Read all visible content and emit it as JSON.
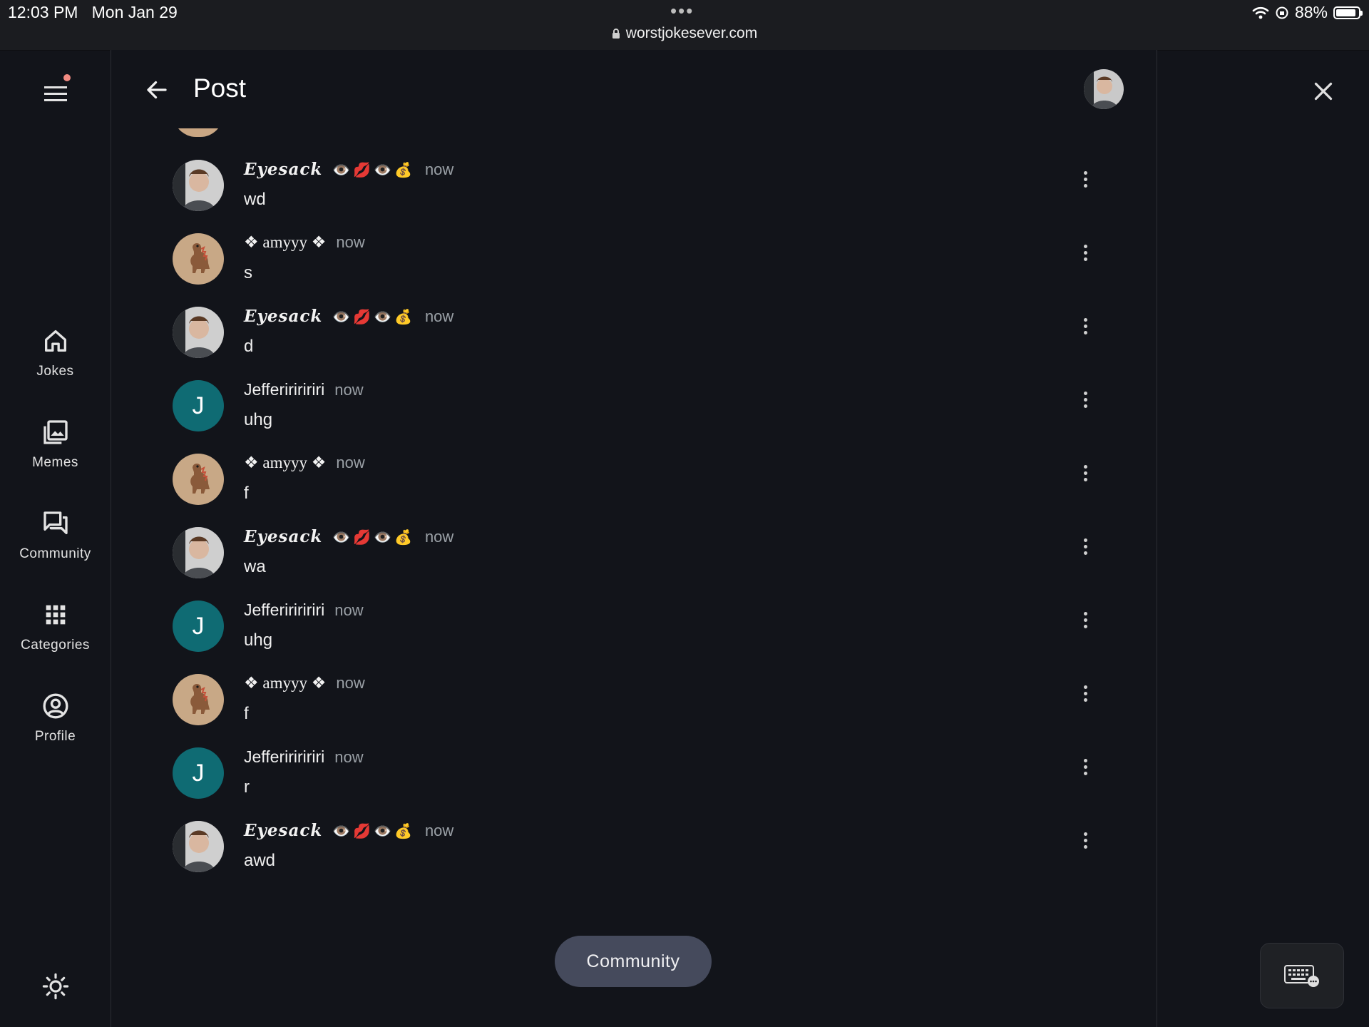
{
  "status_bar": {
    "time": "12:03 PM",
    "date": "Mon Jan 29",
    "url": "worstjokesever.com",
    "battery": "88%",
    "more_dots": "•••"
  },
  "nav": {
    "items": [
      {
        "label": "Jokes",
        "icon": "home-icon"
      },
      {
        "label": "Memes",
        "icon": "image-gallery-icon"
      },
      {
        "label": "Community",
        "icon": "forum-icon"
      },
      {
        "label": "Categories",
        "icon": "grid-icon"
      },
      {
        "label": "Profile",
        "icon": "account-circle-icon"
      }
    ],
    "menu_icon": "hamburger-menu-icon",
    "theme_icon": "brightness-icon"
  },
  "header": {
    "title": "Post",
    "back_icon": "arrow-left-icon",
    "close_icon": "close-icon"
  },
  "comments": [
    {
      "author": "Eyesack",
      "emojis": "👁️💋👁️💰",
      "time": "now",
      "text": "wd",
      "avatar": "photo"
    },
    {
      "author": "❖ amyyy ❖",
      "emojis": "",
      "time": "now",
      "text": "s",
      "avatar": "dino"
    },
    {
      "author": "Eyesack",
      "emojis": "👁️💋👁️💰",
      "time": "now",
      "text": "d",
      "avatar": "photo"
    },
    {
      "author": "Jeffeririririri",
      "emojis": "",
      "time": "now",
      "text": "uhg",
      "avatar": "J"
    },
    {
      "author": "❖ amyyy ❖",
      "emojis": "",
      "time": "now",
      "text": "f",
      "avatar": "dino"
    },
    {
      "author": "Eyesack",
      "emojis": "👁️💋👁️💰",
      "time": "now",
      "text": "wa",
      "avatar": "photo"
    },
    {
      "author": "Jeffeririririri",
      "emojis": "",
      "time": "now",
      "text": "uhg",
      "avatar": "J"
    },
    {
      "author": "❖ amyyy ❖",
      "emojis": "",
      "time": "now",
      "text": "f",
      "avatar": "dino"
    },
    {
      "author": "Jeffeririririri",
      "emojis": "",
      "time": "now",
      "text": "r",
      "avatar": "J"
    },
    {
      "author": "Eyesack",
      "emojis": "👁️💋👁️💰",
      "time": "now",
      "text": "awd",
      "avatar": "photo"
    }
  ],
  "floating": {
    "community_label": "Community",
    "keyboard_icon": "keyboard-icon"
  },
  "colors": {
    "background": "#12141a",
    "avatar_j": "#0f6b73",
    "pill": "#454a5c",
    "notification_dot": "#f28b82"
  }
}
